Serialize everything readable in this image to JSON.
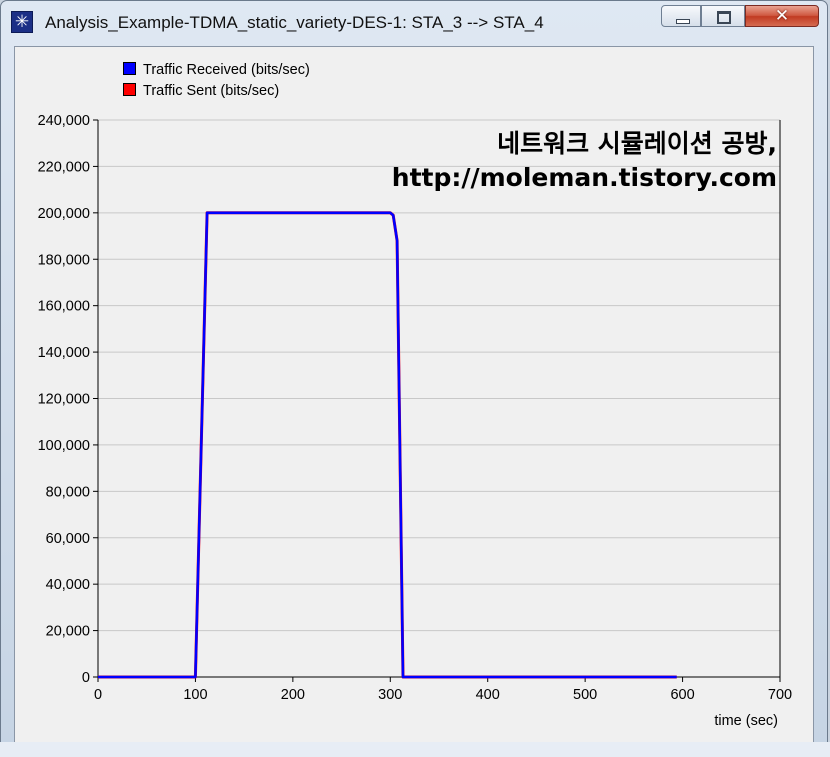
{
  "window": {
    "title": "Analysis_Example-TDMA_static_variety-DES-1: STA_3 --> STA_4",
    "app_icon": "asterisk-star-icon",
    "controls": {
      "minimize": "minimize-icon",
      "maximize": "maximize-icon",
      "close_glyph": "✕"
    }
  },
  "watermark": {
    "line1": "네트워크 시뮬레이션 공방,",
    "line2": "http://moleman.tistory.com"
  },
  "chart_data": {
    "type": "line",
    "title": "",
    "xlabel": "time (sec)",
    "ylabel": "",
    "xlim": [
      0,
      700
    ],
    "ylim": [
      0,
      240000
    ],
    "grid": true,
    "legend_placement": "top-left",
    "x_ticks": [
      "0",
      "100",
      "200",
      "300",
      "400",
      "500",
      "600",
      "700"
    ],
    "y_ticks": [
      "0",
      "20,000",
      "40,000",
      "60,000",
      "80,000",
      "100,000",
      "120,000",
      "140,000",
      "160,000",
      "180,000",
      "200,000",
      "220,000",
      "240,000"
    ],
    "series": [
      {
        "name": "Traffic Received (bits/sec)",
        "color": "#0000ff",
        "x": [
          0,
          100,
          112,
          300,
          303,
          307,
          313,
          594
        ],
        "y": [
          0,
          0,
          200000,
          200000,
          199000,
          188000,
          0,
          0
        ]
      },
      {
        "name": "Traffic Sent (bits/sec)",
        "color": "#ff0000",
        "x": [
          0,
          100,
          112,
          300,
          303,
          307,
          313,
          594
        ],
        "y": [
          0,
          0,
          200000,
          200000,
          199000,
          188000,
          0,
          0
        ]
      }
    ]
  }
}
